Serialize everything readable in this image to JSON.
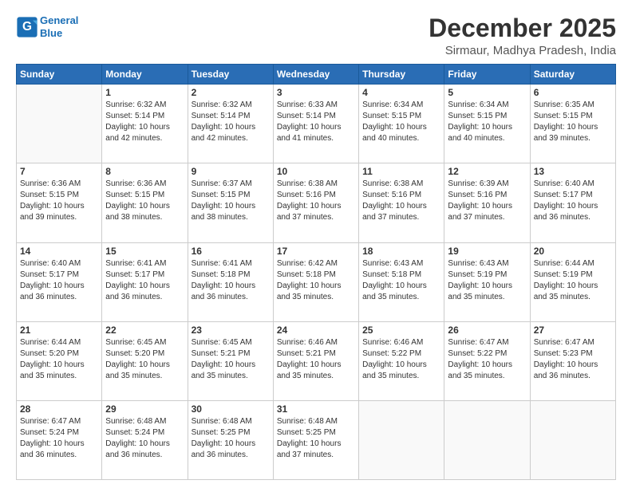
{
  "logo": {
    "line1": "General",
    "line2": "Blue"
  },
  "title": "December 2025",
  "location": "Sirmaur, Madhya Pradesh, India",
  "weekdays": [
    "Sunday",
    "Monday",
    "Tuesday",
    "Wednesday",
    "Thursday",
    "Friday",
    "Saturday"
  ],
  "weeks": [
    [
      {
        "day": "",
        "info": ""
      },
      {
        "day": "1",
        "info": "Sunrise: 6:32 AM\nSunset: 5:14 PM\nDaylight: 10 hours\nand 42 minutes."
      },
      {
        "day": "2",
        "info": "Sunrise: 6:32 AM\nSunset: 5:14 PM\nDaylight: 10 hours\nand 42 minutes."
      },
      {
        "day": "3",
        "info": "Sunrise: 6:33 AM\nSunset: 5:14 PM\nDaylight: 10 hours\nand 41 minutes."
      },
      {
        "day": "4",
        "info": "Sunrise: 6:34 AM\nSunset: 5:15 PM\nDaylight: 10 hours\nand 40 minutes."
      },
      {
        "day": "5",
        "info": "Sunrise: 6:34 AM\nSunset: 5:15 PM\nDaylight: 10 hours\nand 40 minutes."
      },
      {
        "day": "6",
        "info": "Sunrise: 6:35 AM\nSunset: 5:15 PM\nDaylight: 10 hours\nand 39 minutes."
      }
    ],
    [
      {
        "day": "7",
        "info": "Sunrise: 6:36 AM\nSunset: 5:15 PM\nDaylight: 10 hours\nand 39 minutes."
      },
      {
        "day": "8",
        "info": "Sunrise: 6:36 AM\nSunset: 5:15 PM\nDaylight: 10 hours\nand 38 minutes."
      },
      {
        "day": "9",
        "info": "Sunrise: 6:37 AM\nSunset: 5:15 PM\nDaylight: 10 hours\nand 38 minutes."
      },
      {
        "day": "10",
        "info": "Sunrise: 6:38 AM\nSunset: 5:16 PM\nDaylight: 10 hours\nand 37 minutes."
      },
      {
        "day": "11",
        "info": "Sunrise: 6:38 AM\nSunset: 5:16 PM\nDaylight: 10 hours\nand 37 minutes."
      },
      {
        "day": "12",
        "info": "Sunrise: 6:39 AM\nSunset: 5:16 PM\nDaylight: 10 hours\nand 37 minutes."
      },
      {
        "day": "13",
        "info": "Sunrise: 6:40 AM\nSunset: 5:17 PM\nDaylight: 10 hours\nand 36 minutes."
      }
    ],
    [
      {
        "day": "14",
        "info": "Sunrise: 6:40 AM\nSunset: 5:17 PM\nDaylight: 10 hours\nand 36 minutes."
      },
      {
        "day": "15",
        "info": "Sunrise: 6:41 AM\nSunset: 5:17 PM\nDaylight: 10 hours\nand 36 minutes."
      },
      {
        "day": "16",
        "info": "Sunrise: 6:41 AM\nSunset: 5:18 PM\nDaylight: 10 hours\nand 36 minutes."
      },
      {
        "day": "17",
        "info": "Sunrise: 6:42 AM\nSunset: 5:18 PM\nDaylight: 10 hours\nand 35 minutes."
      },
      {
        "day": "18",
        "info": "Sunrise: 6:43 AM\nSunset: 5:18 PM\nDaylight: 10 hours\nand 35 minutes."
      },
      {
        "day": "19",
        "info": "Sunrise: 6:43 AM\nSunset: 5:19 PM\nDaylight: 10 hours\nand 35 minutes."
      },
      {
        "day": "20",
        "info": "Sunrise: 6:44 AM\nSunset: 5:19 PM\nDaylight: 10 hours\nand 35 minutes."
      }
    ],
    [
      {
        "day": "21",
        "info": "Sunrise: 6:44 AM\nSunset: 5:20 PM\nDaylight: 10 hours\nand 35 minutes."
      },
      {
        "day": "22",
        "info": "Sunrise: 6:45 AM\nSunset: 5:20 PM\nDaylight: 10 hours\nand 35 minutes."
      },
      {
        "day": "23",
        "info": "Sunrise: 6:45 AM\nSunset: 5:21 PM\nDaylight: 10 hours\nand 35 minutes."
      },
      {
        "day": "24",
        "info": "Sunrise: 6:46 AM\nSunset: 5:21 PM\nDaylight: 10 hours\nand 35 minutes."
      },
      {
        "day": "25",
        "info": "Sunrise: 6:46 AM\nSunset: 5:22 PM\nDaylight: 10 hours\nand 35 minutes."
      },
      {
        "day": "26",
        "info": "Sunrise: 6:47 AM\nSunset: 5:22 PM\nDaylight: 10 hours\nand 35 minutes."
      },
      {
        "day": "27",
        "info": "Sunrise: 6:47 AM\nSunset: 5:23 PM\nDaylight: 10 hours\nand 36 minutes."
      }
    ],
    [
      {
        "day": "28",
        "info": "Sunrise: 6:47 AM\nSunset: 5:24 PM\nDaylight: 10 hours\nand 36 minutes."
      },
      {
        "day": "29",
        "info": "Sunrise: 6:48 AM\nSunset: 5:24 PM\nDaylight: 10 hours\nand 36 minutes."
      },
      {
        "day": "30",
        "info": "Sunrise: 6:48 AM\nSunset: 5:25 PM\nDaylight: 10 hours\nand 36 minutes."
      },
      {
        "day": "31",
        "info": "Sunrise: 6:48 AM\nSunset: 5:25 PM\nDaylight: 10 hours\nand 37 minutes."
      },
      {
        "day": "",
        "info": ""
      },
      {
        "day": "",
        "info": ""
      },
      {
        "day": "",
        "info": ""
      }
    ]
  ]
}
